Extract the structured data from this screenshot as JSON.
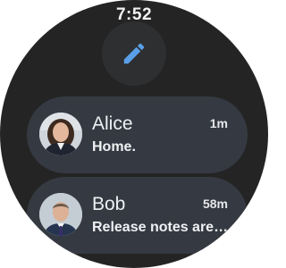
{
  "status_bar": {
    "time": "7:52"
  },
  "compose": {
    "icon": "pencil-icon",
    "accent": "#5aa0e8"
  },
  "conversations": [
    {
      "name": "Alice",
      "ago": "1m",
      "preview": "Home."
    },
    {
      "name": "Bob",
      "ago": "58m",
      "preview": "Release notes are…"
    }
  ],
  "colors": {
    "background": "#242424",
    "chip": "#353a42",
    "button": "#2e2f31"
  }
}
